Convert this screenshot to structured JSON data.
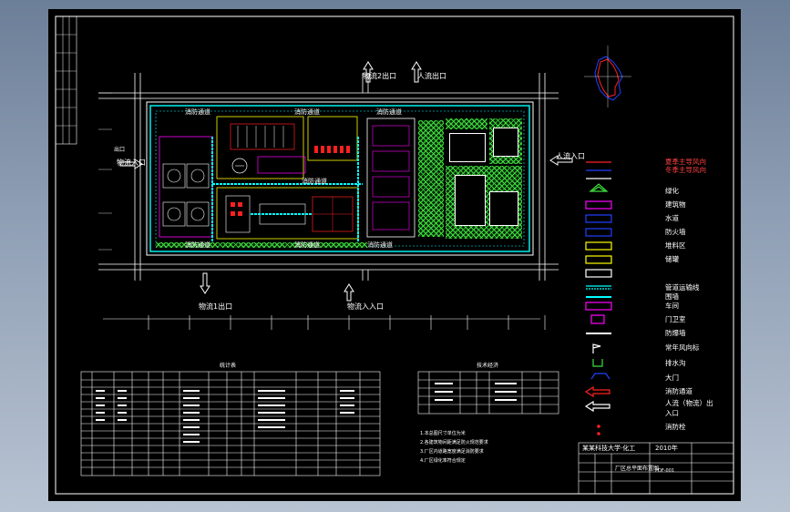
{
  "colors": {
    "background_gradient_top": "#6c7f98",
    "canvas": "#000000",
    "frame": "#ffffff",
    "road": "#00ffff",
    "boundary": "#ffffff",
    "wall": "#ffff00",
    "greenery": "#3ee03e",
    "accent_red": "#ff2020",
    "accent_magenta": "#ff00ff",
    "accent_blue": "#2040ff"
  },
  "plan": {
    "gates": {
      "top_exit": "物流2出口",
      "top_entry": "人流出口",
      "right_entry": "人流入口",
      "left_exit": "物流入口",
      "left_side": "出口",
      "bottom_exit": "物流1出口",
      "bottom_entry": "物流入入口"
    },
    "roads": {
      "top_left": "消防通道",
      "top_mid": "消防通道",
      "top_right": "消防通道",
      "bottom_left": "消防通道",
      "bottom_mid": "消防通道",
      "bottom_right": "消防通道",
      "middle": "消防通道"
    }
  },
  "legend": {
    "items": [
      {
        "label": "夏季主导风向",
        "color": "#ff2020"
      },
      {
        "label": "冬季主导风向",
        "color": "#2040ff"
      },
      {
        "label": "",
        "color": "#ffffff"
      },
      {
        "label": "绿化",
        "color": "#3ee03e"
      },
      {
        "label": "建筑物",
        "color": "#ff00ff"
      },
      {
        "label": "水道",
        "color": "#2040ff"
      },
      {
        "label": "防火墙",
        "color": "#2040ff"
      },
      {
        "label": "堆料区",
        "color": "#ffff00"
      },
      {
        "label": "储罐",
        "color": "#ffff00"
      },
      {
        "label": "",
        "color": "#ffffff"
      },
      {
        "label": "管道运输线",
        "color": "#00ffff"
      },
      {
        "label": "围墙",
        "color": "#00ffff"
      },
      {
        "label": "车间",
        "color": "#ff00ff"
      },
      {
        "label": "门卫室",
        "color": "#ff00ff"
      },
      {
        "label": "防爆墙",
        "color": "#ffffff"
      },
      {
        "label": "常年风向标",
        "color": "#ffffff"
      },
      {
        "label": "排水沟",
        "color": "#3ee03e"
      },
      {
        "label": "大门",
        "color": "#2040ff"
      },
      {
        "label": "消防通道",
        "color": "#ff2020"
      },
      {
        "label": "人流（物流）出",
        "color": "#ffffff"
      },
      {
        "label": "入口",
        "color": "#ffffff"
      },
      {
        "label": "消防栓",
        "color": "#ff2020"
      }
    ]
  },
  "tables": {
    "table1_title": "统计表",
    "table2_title": "技术经济",
    "notes": [
      "1.本总图尺寸单位为米",
      "2.各建筑物间距满足防火规范要求",
      "3.厂区内道路宽度满足消防要求",
      "4.厂区绿化率符合规定"
    ]
  },
  "title_block": {
    "org": "某某科技大学·化工",
    "year": "2010年",
    "drawing_title": "厂区总平面布置图",
    "drawing_no": "PDF-001"
  }
}
